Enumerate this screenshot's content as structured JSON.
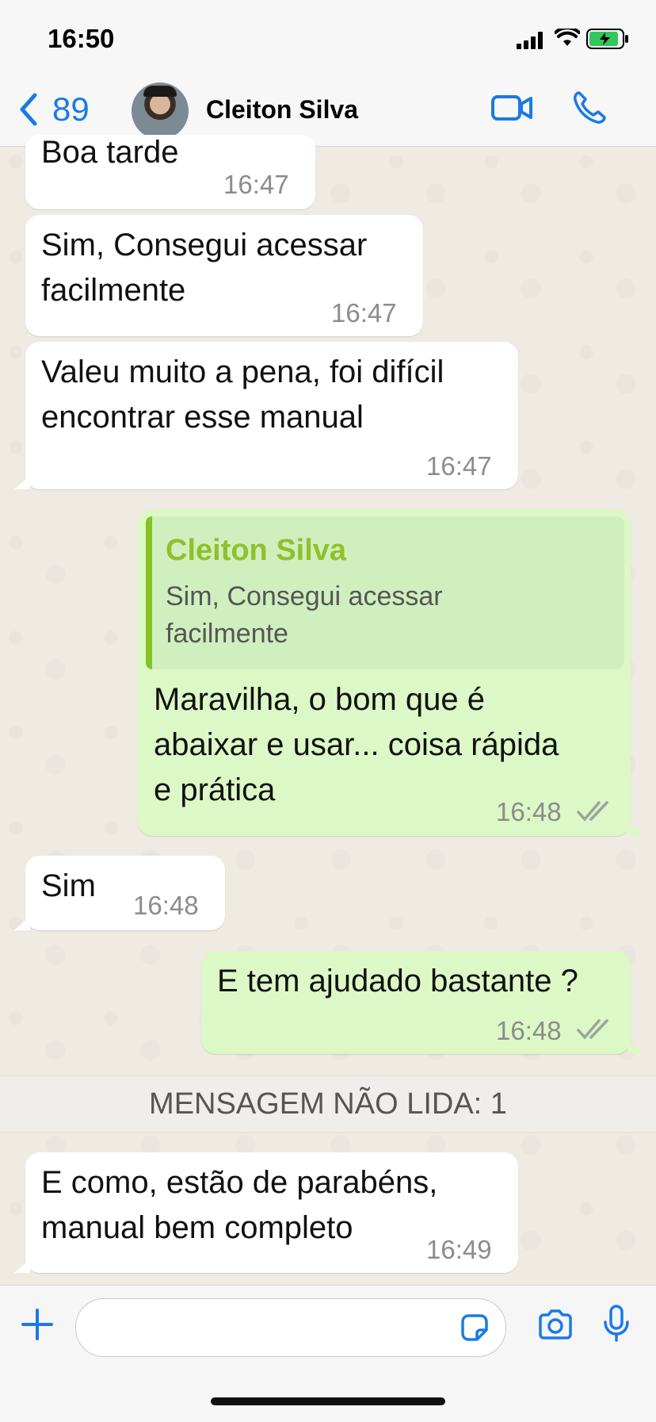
{
  "status_bar": {
    "time": "16:50"
  },
  "header": {
    "back_count": "89",
    "contact_name": "Cleiton Silva"
  },
  "messages": [
    {
      "direction": "in",
      "text_lines": [
        "Boa tarde"
      ],
      "time": "16:47"
    },
    {
      "direction": "in",
      "text_lines": [
        "Sim, Consegui acessar",
        "facilmente"
      ],
      "time": "16:47"
    },
    {
      "direction": "in",
      "text_lines": [
        "Valeu muito a pena, foi difícil",
        "encontrar esse manual"
      ],
      "time": "16:47"
    },
    {
      "direction": "out",
      "quote": {
        "name": "Cleiton Silva",
        "text_lines": [
          "Sim, Consegui acessar",
          "facilmente"
        ]
      },
      "text_lines": [
        "Maravilha, o bom que é",
        "abaixar e usar... coisa rápida",
        "e prática"
      ],
      "time": "16:48",
      "read": true
    },
    {
      "direction": "in",
      "text_lines": [
        "Sim"
      ],
      "time": "16:48"
    },
    {
      "direction": "out",
      "text_lines": [
        "E tem ajudado bastante ?"
      ],
      "time": "16:48",
      "read": true
    },
    {
      "direction": "in",
      "text_lines": [
        "E como, estão de parabéns,",
        "manual bem completo"
      ],
      "time": "16:49"
    }
  ],
  "unread_banner": "MENSAGEM NÃO LIDA: 1",
  "composer": {
    "placeholder": ""
  },
  "colors": {
    "accent": "#1a7ae6",
    "outgoing": "#dcf8c6",
    "incoming": "#ffffff",
    "quote_name": "#8ec12a"
  }
}
